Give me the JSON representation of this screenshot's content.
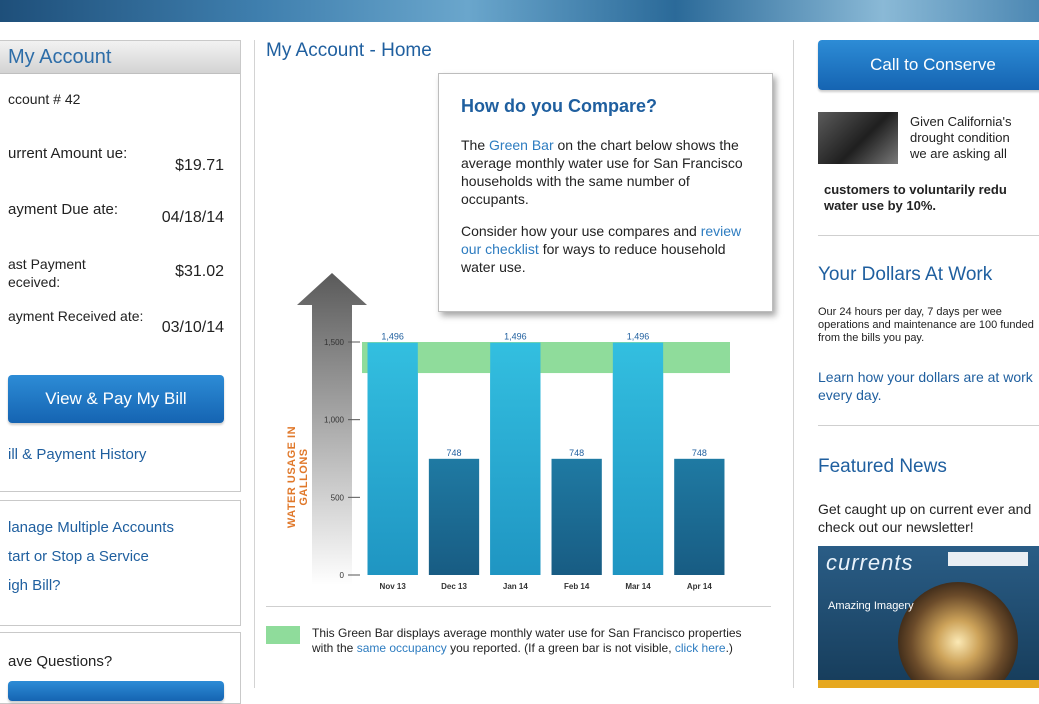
{
  "left": {
    "title": "My Account",
    "account_number": "ccount # 42",
    "rows": [
      {
        "label": "urrent Amount ue:",
        "value": "$19.71"
      },
      {
        "label": "ayment Due ate:",
        "value": "04/18/14"
      },
      {
        "label": "ast Payment eceived:",
        "value": "$31.02"
      },
      {
        "label": "ayment Received ate:",
        "value": "03/10/14"
      }
    ],
    "pay_button": "View & Pay My Bill",
    "history_link": "ill & Payment History",
    "links": [
      "lanage Multiple Accounts",
      "tart or Stop a Service",
      "igh Bill?"
    ],
    "questions": "ave Questions?"
  },
  "main": {
    "title": "My Account - Home",
    "compare": {
      "heading": "How do you Compare?",
      "p1_a": "The ",
      "p1_link": "Green Bar",
      "p1_b": " on the chart below shows the average monthly water use for San Francisco households with the same number of occupants.",
      "p2_a": "Consider how your use compares and ",
      "p2_link": "review our checklist",
      "p2_b": " for ways to reduce household water use."
    },
    "legend": {
      "text_a": "This Green Bar displays average monthly water use for San Francisco properties with the ",
      "link1": "same occupancy",
      "text_b": " you reported. (If a green bar is not visible, ",
      "link2": "click here",
      "text_c": ".)"
    }
  },
  "chart_data": {
    "type": "bar",
    "categories": [
      "Nov 13",
      "Dec 13",
      "Jan 14",
      "Feb 14",
      "Mar 14",
      "Apr 14"
    ],
    "values": [
      1496,
      748,
      1496,
      748,
      1496,
      748
    ],
    "value_labels": [
      "1,496",
      "748",
      "1,496",
      "748",
      "1,496",
      "748"
    ],
    "ylabel": "WATER USAGE IN GALLONS",
    "yticks": [
      "0",
      "500",
      "1,000",
      "1,500"
    ],
    "ytick_values": [
      0,
      500,
      1000,
      1500
    ],
    "ylim": [
      0,
      1500
    ],
    "average_band": [
      1300,
      1500
    ],
    "colors": {
      "light_bar": "#2fb6d6",
      "dark_bar": "#1d6e98",
      "band": "#8fdc9b"
    }
  },
  "right": {
    "conserve_button": "Call to Conserve",
    "drought_lines": [
      "Given California's",
      "drought condition",
      "we are asking all"
    ],
    "drought_bold": "customers to voluntarily redu water use by 10%.",
    "dollars_heading": "Your Dollars At Work",
    "dollars_text": "Our 24 hours per day, 7 days per wee operations and maintenance are 100 funded from the bills you pay.",
    "dollars_link": "Learn how your dollars are at work every day.",
    "news_heading": "Featured News",
    "news_text": "Get caught up on current ever and check out our newsletter!",
    "newsletter_logo": "currents",
    "newsletter_caption": "Amazing Imagery"
  }
}
